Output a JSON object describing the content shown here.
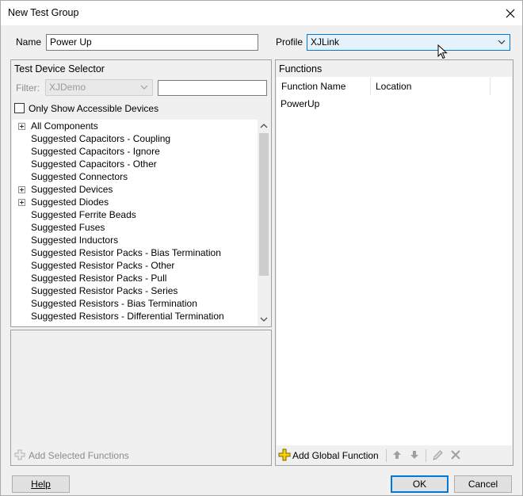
{
  "window": {
    "title": "New Test Group"
  },
  "name_field": {
    "label": "Name",
    "value": "Power Up"
  },
  "profile": {
    "label": "Profile",
    "value": "XJLink"
  },
  "device_selector": {
    "header": "Test Device Selector",
    "filter_label": "Filter:",
    "filter_value": "XJDemo",
    "filter_text": "",
    "accessible_label": "Only Show Accessible Devices",
    "tree": [
      {
        "label": "All Components",
        "expandable": true
      },
      {
        "label": "Suggested Capacitors - Coupling",
        "expandable": false
      },
      {
        "label": "Suggested Capacitors - Ignore",
        "expandable": false
      },
      {
        "label": "Suggested Capacitors - Other",
        "expandable": false
      },
      {
        "label": "Suggested Connectors",
        "expandable": false
      },
      {
        "label": "Suggested Devices",
        "expandable": true
      },
      {
        "label": "Suggested Diodes",
        "expandable": true
      },
      {
        "label": "Suggested Ferrite Beads",
        "expandable": false
      },
      {
        "label": "Suggested Fuses",
        "expandable": false
      },
      {
        "label": "Suggested Inductors",
        "expandable": false
      },
      {
        "label": "Suggested Resistor Packs - Bias Termination",
        "expandable": false
      },
      {
        "label": "Suggested Resistor Packs - Other",
        "expandable": false
      },
      {
        "label": "Suggested Resistor Packs - Pull",
        "expandable": false
      },
      {
        "label": "Suggested Resistor Packs - Series",
        "expandable": false
      },
      {
        "label": "Suggested Resistors - Bias Termination",
        "expandable": false
      },
      {
        "label": "Suggested Resistors - Differential Termination",
        "expandable": false
      }
    ],
    "add_selected_label": "Add Selected Functions"
  },
  "functions": {
    "header": "Functions",
    "columns": [
      "Function Name",
      "Location"
    ],
    "rows": [
      {
        "name": "PowerUp",
        "location": ""
      }
    ],
    "add_global_label": "Add Global Function"
  },
  "buttons": {
    "help": "Help",
    "ok": "OK",
    "cancel": "Cancel"
  },
  "colors": {
    "accent": "#0078d7",
    "combo_bg": "#e5f1fb",
    "add_icon": "#f5d300"
  }
}
